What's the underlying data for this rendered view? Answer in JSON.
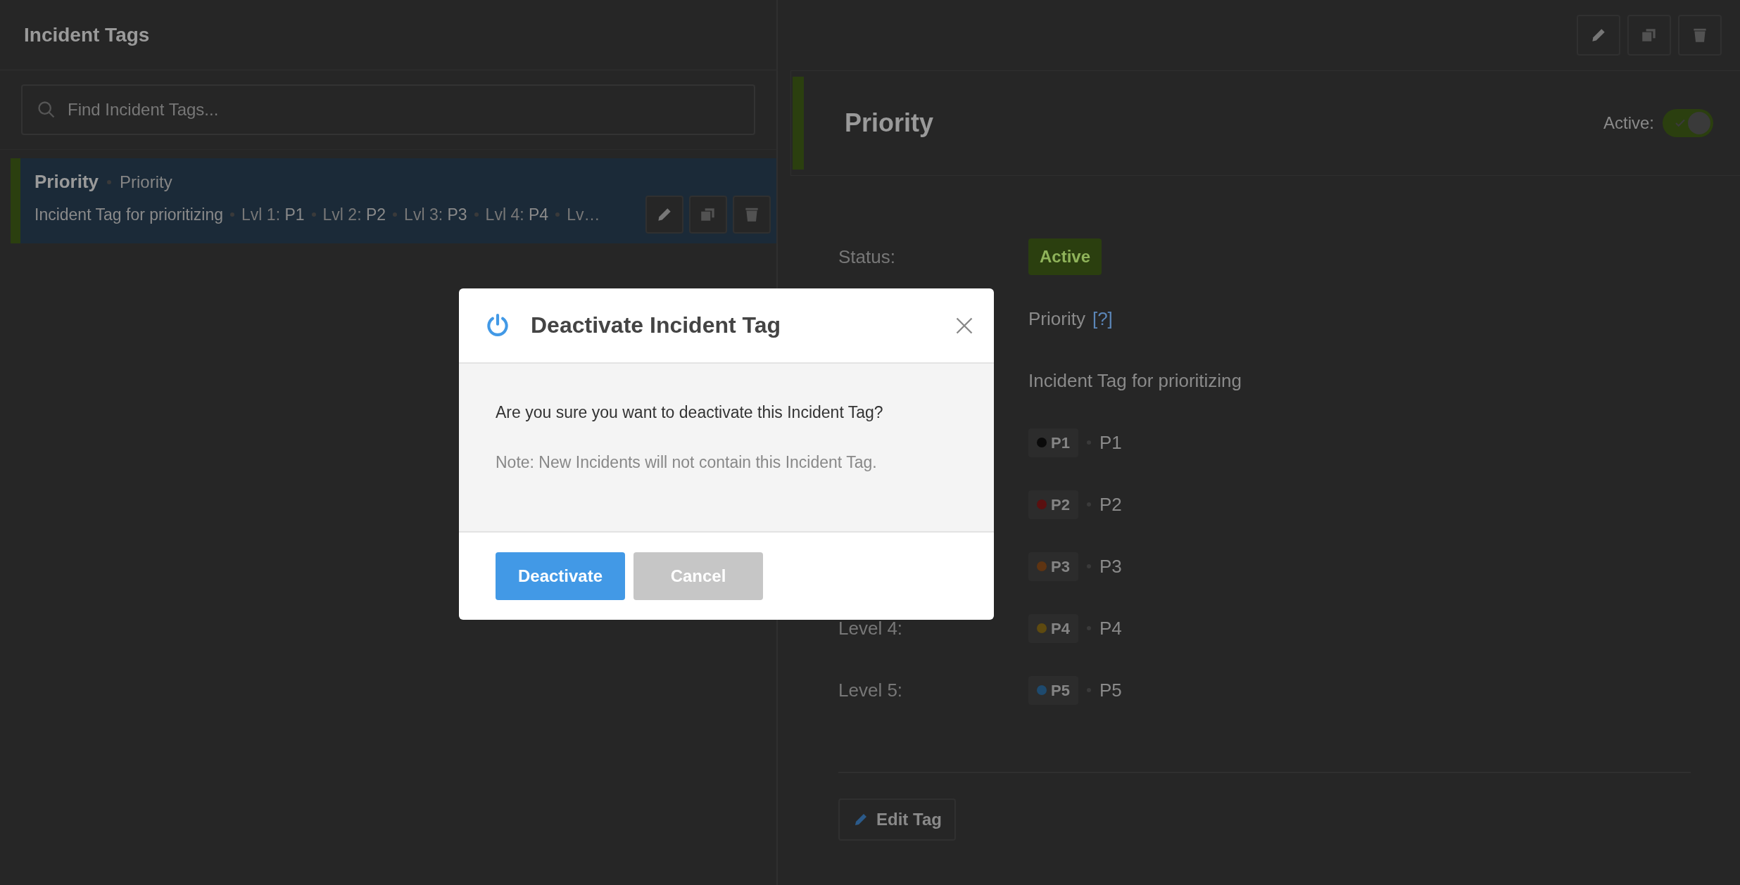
{
  "list_panel": {
    "title": "Incident Tags",
    "search": {
      "placeholder": "Find Incident Tags..."
    },
    "items": [
      {
        "name": "Priority",
        "subtitle": "Priority",
        "description": "Incident Tag for prioritizing",
        "selected": true,
        "color": "#2b3f0f",
        "summary": [
          {
            "label": "Lvl 1:",
            "value": "P1"
          },
          {
            "label": "Lvl 2:",
            "value": "P2"
          },
          {
            "label": "Lvl 3:",
            "value": "P3"
          },
          {
            "label": "Lvl 4:",
            "value": "P4"
          },
          {
            "label": "Lv…"
          }
        ]
      }
    ]
  },
  "detail_panel": {
    "title": "Priority",
    "color": "#2b3f0f",
    "active_label": "Active:",
    "active": true,
    "rows": [
      {
        "kind": "status",
        "label": "Status:",
        "value": "Active"
      },
      {
        "kind": "text",
        "value": "Priority",
        "help": "[?]"
      },
      {
        "kind": "text",
        "value": "Incident Tag for prioritizing"
      },
      {
        "kind": "level",
        "chip": "P1",
        "color": "#0a0a0a",
        "value": "P1"
      },
      {
        "kind": "level",
        "chip": "P2",
        "color": "#5a1010",
        "value": "P2"
      },
      {
        "kind": "level",
        "chip": "P3",
        "color": "#5e3412",
        "value": "P3"
      },
      {
        "kind": "level",
        "label": "Level 4:",
        "chip": "P4",
        "color": "#5e4a10",
        "value": "P4"
      },
      {
        "kind": "level",
        "label": "Level 5:",
        "chip": "P5",
        "color": "#1e4a6e",
        "value": "P5"
      }
    ],
    "edit_button": "Edit Tag"
  },
  "dialog": {
    "title": "Deactivate Incident Tag",
    "message": "Are you sure you want to deactivate this Incident Tag?",
    "note": "Note: New Incidents will not contain this Incident Tag.",
    "buttons": [
      {
        "label": "Deactivate",
        "kind": "primary"
      },
      {
        "label": "Cancel",
        "kind": "secondary"
      }
    ]
  }
}
